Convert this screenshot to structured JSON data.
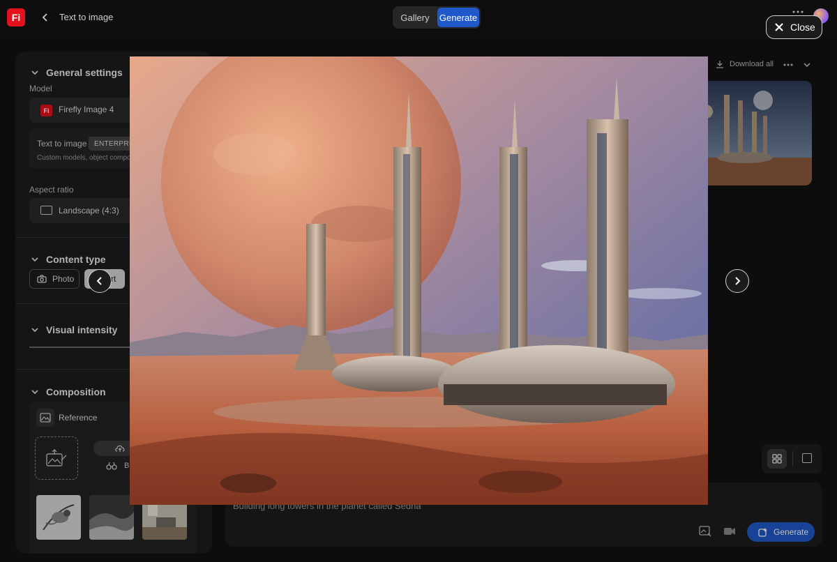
{
  "topbar": {
    "app_logo": "Fi",
    "crumb": "Text to image",
    "tabs": [
      {
        "label": "Gallery",
        "active": false
      },
      {
        "label": "Generate",
        "active": true
      }
    ],
    "icons": [
      "back-icon",
      "apps-icon",
      "avatar"
    ]
  },
  "left_panel": {
    "general_settings": {
      "title": "General settings",
      "model_label": "Model",
      "model_logo": "Fi",
      "model_name": "Firefly Image 4",
      "info_title": "Text to image",
      "info_badge": "ENTERPRISE",
      "info_sub": "Custom models, object compos",
      "aspect_label": "Aspect ratio",
      "aspect_value": "Landscape (4:3)"
    },
    "content_type": {
      "title": "Content type",
      "photo_label": "Photo",
      "art_label": "Art"
    },
    "visual_intensity": {
      "title": "Visual intensity"
    },
    "composition": {
      "title": "Composition",
      "reference_label": "Reference",
      "browse_label": "B"
    }
  },
  "right": {
    "download_all": "Download all"
  },
  "prompt": {
    "text": "Building long towers in the planet called Sedna",
    "generate_label": "Generate"
  },
  "modal": {
    "close_label": "Close"
  },
  "colors": {
    "accent": "#1f59c9",
    "brand": "#e3121e",
    "panel": "#1c1c1c",
    "background": "#121212"
  }
}
